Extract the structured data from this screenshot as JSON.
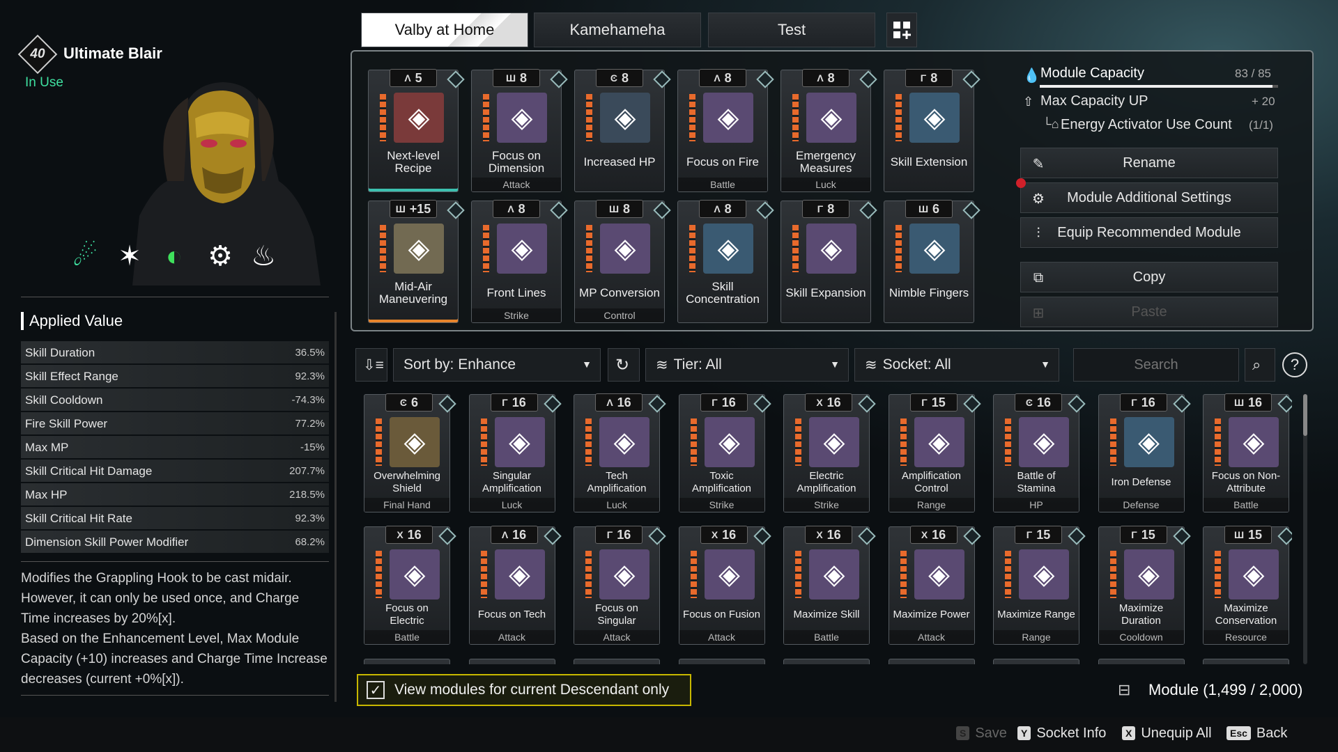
{
  "character": {
    "level": "40",
    "name": "Ultimate Blair",
    "status": "In Use"
  },
  "loadout_tabs": [
    "Valby at Home",
    "Kamehameha",
    "Test"
  ],
  "applied_value": {
    "title": "Applied Value",
    "stats": [
      {
        "name": "Skill Duration",
        "value": "36.5%"
      },
      {
        "name": "Skill Effect Range",
        "value": "92.3%"
      },
      {
        "name": "Skill Cooldown",
        "value": "-74.3%"
      },
      {
        "name": "Fire Skill Power",
        "value": "77.2%"
      },
      {
        "name": "Max MP",
        "value": "-15%"
      },
      {
        "name": "Skill Critical Hit Damage",
        "value": "207.7%"
      },
      {
        "name": "Max HP",
        "value": "218.5%"
      },
      {
        "name": "Skill Critical Hit Rate",
        "value": "92.3%"
      },
      {
        "name": "Dimension Skill Power Modifier",
        "value": "68.2%"
      }
    ],
    "description": "Modifies the Grappling Hook to be cast midair. However, it can only be used once, and Charge Time increases by 20%[x].\nBased on the Enhancement Level, Max Module Capacity (+10) increases and Charge Time Increase decreases (current +0%[x])."
  },
  "equipped": [
    {
      "socket": "Λ",
      "cost": "5",
      "name": "Next-level Recipe",
      "category": "",
      "icon": "skull-icon",
      "bg": "#7a3a3a",
      "accent": "teal"
    },
    {
      "socket": "Ш",
      "cost": "8",
      "name": "Focus on Dimension",
      "category": "Attack",
      "icon": "dimension-icon",
      "bg": "#5a4a72",
      "accent": ""
    },
    {
      "socket": "Ͼ",
      "cost": "8",
      "name": "Increased HP",
      "category": "",
      "icon": "heart-hands-icon",
      "bg": "#3a4a5a",
      "accent": ""
    },
    {
      "socket": "Λ",
      "cost": "8",
      "name": "Focus on Fire",
      "category": "Battle",
      "icon": "fire-diamond-icon",
      "bg": "#5a4a72",
      "accent": ""
    },
    {
      "socket": "Λ",
      "cost": "8",
      "name": "Emergency Measures",
      "category": "Luck",
      "icon": "emergency-icon",
      "bg": "#5a4a72",
      "accent": ""
    },
    {
      "socket": "Γ",
      "cost": "8",
      "name": "Skill Extension",
      "category": "",
      "icon": "skill-extension-icon",
      "bg": "#3a5a72",
      "accent": ""
    },
    {
      "socket": "Ш",
      "cost": "+15",
      "name": "Mid-Air Maneuvering",
      "category": "",
      "icon": "grapple-icon",
      "bg": "#726a52",
      "accent": "orange"
    },
    {
      "socket": "Λ",
      "cost": "8",
      "name": "Front Lines",
      "category": "Strike",
      "icon": "front-lines-icon",
      "bg": "#5a4a72",
      "accent": ""
    },
    {
      "socket": "Ш",
      "cost": "8",
      "name": "MP Conversion",
      "category": "Control",
      "icon": "mp-conversion-icon",
      "bg": "#5a4a72",
      "accent": ""
    },
    {
      "socket": "Λ",
      "cost": "8",
      "name": "Skill Concentration",
      "category": "",
      "icon": "skill-concentration-icon",
      "bg": "#3a5a72",
      "accent": ""
    },
    {
      "socket": "Γ",
      "cost": "8",
      "name": "Skill Expansion",
      "category": "",
      "icon": "skill-expansion-icon",
      "bg": "#5a4a72",
      "accent": ""
    },
    {
      "socket": "Ш",
      "cost": "6",
      "name": "Nimble Fingers",
      "category": "",
      "icon": "nimble-fingers-icon",
      "bg": "#3a5a72",
      "accent": ""
    }
  ],
  "capacity": {
    "label": "Module Capacity",
    "value": "83 / 85",
    "fill": 0.976,
    "max_label": "Max Capacity UP",
    "max_value": "+ 20",
    "energy_label": "Energy Activator Use Count",
    "energy_value": "(1/1)"
  },
  "actions": {
    "rename": "Rename",
    "additional": "Module Additional Settings",
    "recommend": "Equip Recommended Module",
    "copy": "Copy",
    "paste": "Paste"
  },
  "filters": {
    "sort": "Sort by: Enhance",
    "tier": "Tier: All",
    "socket": "Socket: All",
    "search_placeholder": "Search"
  },
  "inventory": [
    {
      "socket": "Ͼ",
      "cost": "6",
      "name": "Overwhelming Shield",
      "category": "Final Hand",
      "bg": "#6a5a3a"
    },
    {
      "socket": "Γ",
      "cost": "16",
      "name": "Singular Amplification",
      "category": "Luck",
      "bg": "#5a4a72"
    },
    {
      "socket": "Λ",
      "cost": "16",
      "name": "Tech Amplification",
      "category": "Luck",
      "bg": "#5a4a72"
    },
    {
      "socket": "Γ",
      "cost": "16",
      "name": "Toxic Amplification",
      "category": "Strike",
      "bg": "#5a4a72"
    },
    {
      "socket": "Χ",
      "cost": "16",
      "name": "Electric Amplification",
      "category": "Strike",
      "bg": "#5a4a72"
    },
    {
      "socket": "Γ",
      "cost": "15",
      "name": "Amplification Control",
      "category": "Range",
      "bg": "#5a4a72"
    },
    {
      "socket": "Ͼ",
      "cost": "16",
      "name": "Battle of Stamina",
      "category": "HP",
      "bg": "#5a4a72"
    },
    {
      "socket": "Γ",
      "cost": "16",
      "name": "Iron Defense",
      "category": "Defense",
      "bg": "#3a5a72"
    },
    {
      "socket": "Ш",
      "cost": "16",
      "name": "Focus on Non-Attribute",
      "category": "Battle",
      "bg": "#5a4a72"
    },
    {
      "socket": "Χ",
      "cost": "16",
      "name": "Focus on Electric",
      "category": "Battle",
      "bg": "#5a4a72"
    },
    {
      "socket": "Λ",
      "cost": "16",
      "name": "Focus on Tech",
      "category": "Attack",
      "bg": "#5a4a72"
    },
    {
      "socket": "Γ",
      "cost": "16",
      "name": "Focus on Singular",
      "category": "Attack",
      "bg": "#5a4a72"
    },
    {
      "socket": "Χ",
      "cost": "16",
      "name": "Focus on Fusion",
      "category": "Attack",
      "bg": "#5a4a72"
    },
    {
      "socket": "Χ",
      "cost": "16",
      "name": "Maximize Skill",
      "category": "Battle",
      "bg": "#5a4a72"
    },
    {
      "socket": "Χ",
      "cost": "16",
      "name": "Maximize Power",
      "category": "Attack",
      "bg": "#5a4a72"
    },
    {
      "socket": "Γ",
      "cost": "15",
      "name": "Maximize Range",
      "category": "Range",
      "bg": "#5a4a72"
    },
    {
      "socket": "Γ",
      "cost": "15",
      "name": "Maximize Duration",
      "category": "Cooldown",
      "bg": "#5a4a72"
    },
    {
      "socket": "Ш",
      "cost": "15",
      "name": "Maximize Conservation",
      "category": "Resource",
      "bg": "#5a4a72"
    }
  ],
  "view_current_only": "View modules for current Descendant only",
  "module_count": "Module (1,499 / 2,000)",
  "footer": [
    {
      "key": "S",
      "label": "Save",
      "enabled": false
    },
    {
      "key": "Y",
      "label": "Socket Info",
      "enabled": true
    },
    {
      "key": "X",
      "label": "Unequip All",
      "enabled": true
    },
    {
      "key": "Esc",
      "label": "Back",
      "enabled": true
    }
  ]
}
